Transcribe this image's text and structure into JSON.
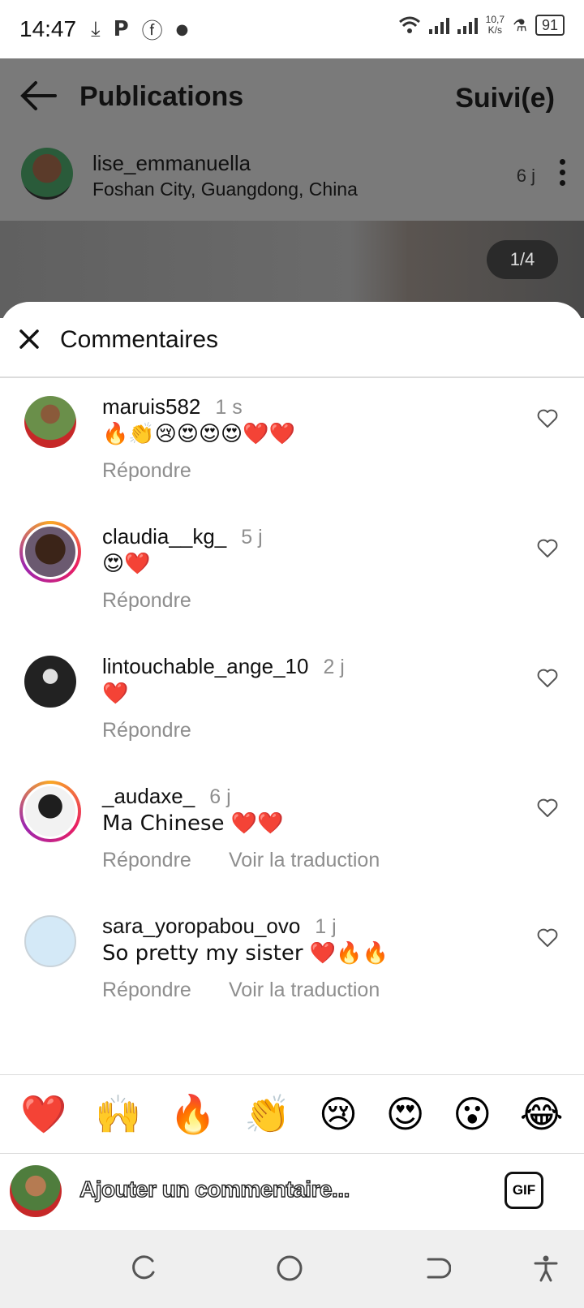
{
  "status_bar": {
    "time": "14:47",
    "speed_value": "10,7",
    "speed_unit": "K/s",
    "battery": "91",
    "icons": [
      "download-icon",
      "p-app-icon",
      "facebook-icon",
      "dot-icon",
      "wifi-icon",
      "signal-icon",
      "lab-icon",
      "battery-icon"
    ]
  },
  "header": {
    "title": "Publications",
    "follow_label": "Suivi(e)"
  },
  "post": {
    "username": "lise_emmanuella",
    "location": "Foshan City, Guangdong, China",
    "age": "6 j",
    "counter": "1/4"
  },
  "sheet": {
    "title": "Commentaires",
    "comments": [
      {
        "username": "maruis582",
        "time": "1 s",
        "text": "🔥👏😢😍😍😍❤️❤️",
        "reply": "Répondre",
        "translate": ""
      },
      {
        "username": "claudia__kg_",
        "time": "5 j",
        "text": "😍❤️",
        "reply": "Répondre",
        "translate": ""
      },
      {
        "username": "lintouchable_ange_10",
        "time": "2 j",
        "text": "❤️",
        "reply": "Répondre",
        "translate": ""
      },
      {
        "username": "_audaxe_",
        "time": "6 j",
        "text": "Ma Chinese ❤️❤️",
        "reply": "Répondre",
        "translate": "Voir la traduction"
      },
      {
        "username": "sara_yoropabou_ovo",
        "time": "1 j",
        "text": "So pretty my sister ❤️🔥🔥",
        "reply": "Répondre",
        "translate": "Voir la traduction"
      }
    ]
  },
  "emoji_bar": [
    "❤️",
    "🙌",
    "🔥",
    "👏",
    "😢",
    "😍",
    "😮",
    "😂"
  ],
  "composer": {
    "placeholder": "Ajouter un commentaire...",
    "gif_label": "GIF"
  },
  "colors": {
    "secondary_text": "#8e8e8e",
    "dim_overlay": "#7a7a7a",
    "story_ring": "#e91e63",
    "heart_red": "#e02020"
  }
}
